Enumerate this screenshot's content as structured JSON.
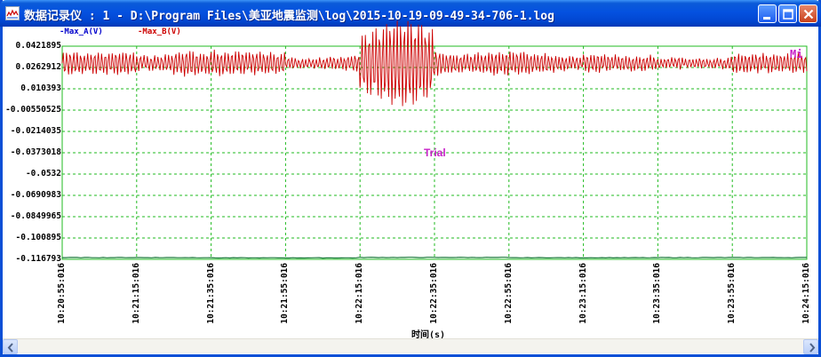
{
  "window": {
    "title": "数据记录仪 : 1 - D:\\Program Files\\美亚地震监测\\log\\2015-10-19-09-49-34-706-1.log",
    "icon": "chart-icon",
    "controls": [
      "minimize-icon",
      "maximize-icon",
      "close-icon"
    ]
  },
  "colors": {
    "series_a": "#0000cc",
    "series_b": "#cc0000",
    "grid": "#22bb22",
    "watermark": "#c822c8"
  },
  "watermark": "Trial",
  "corner_glyph": "Mi",
  "chart_data": {
    "type": "line",
    "xlabel": "时间(s)",
    "ylabel": "",
    "series": [
      {
        "name": "-Max_A(V)",
        "values": [
          -0.1155,
          -0.1157,
          -0.1154,
          -0.1156,
          -0.1155
        ]
      },
      {
        "name": "-Max_B(V)",
        "values": [
          0.025,
          0.027,
          0.034,
          0.028,
          0.041,
          0.03,
          0.029,
          0.027,
          0.028,
          0.026
        ]
      }
    ],
    "x_ticks": [
      "10:20:55:016",
      "10:21:15:016",
      "10:21:35:016",
      "10:21:55:016",
      "10:22:15:016",
      "10:22:35:016",
      "10:22:55:016",
      "10:23:15:016",
      "10:23:35:016",
      "10:23:55:016",
      "10:24:15:016"
    ],
    "y_ticks": [
      "0.0421895",
      "0.0262912",
      "0.010393",
      "-0.00550525",
      "-0.0214035",
      "-0.0373018",
      "-0.0532",
      "-0.0690983",
      "-0.0849965",
      "-0.100895",
      "-0.116793"
    ],
    "ylim": [
      -0.116793,
      0.0421895
    ],
    "grid": true,
    "legend_position": "top-left"
  }
}
